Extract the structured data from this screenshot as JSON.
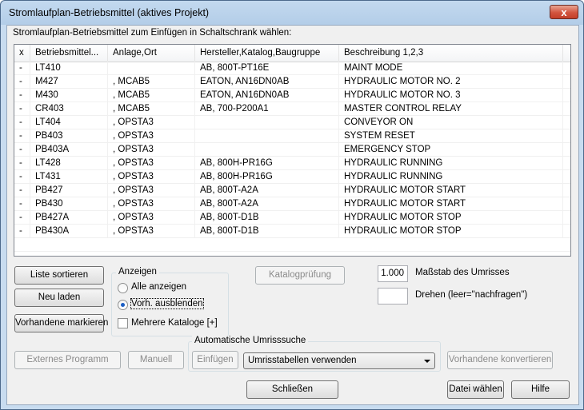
{
  "window": {
    "title": "Stromlaufplan-Betriebsmittel (aktives Projekt)",
    "close_glyph": "x"
  },
  "caption": "Stromlaufplan-Betriebsmittel zum Einfügen in Schaltschrank wählen:",
  "table": {
    "columns": [
      "x",
      "Betriebsmittel...",
      "Anlage,Ort",
      "Hersteller,Katalog,Baugruppe",
      "Beschreibung 1,2,3"
    ],
    "rows": [
      [
        "-",
        "LT410",
        "",
        "AB, 800T-PT16E",
        "MAINT MODE"
      ],
      [
        "-",
        "M427",
        ", MCAB5",
        "EATON, AN16DN0AB",
        "HYDRAULIC MOTOR NO. 2"
      ],
      [
        "-",
        "M430",
        ", MCAB5",
        "EATON, AN16DN0AB",
        "HYDRAULIC MOTOR NO. 3"
      ],
      [
        "-",
        "CR403",
        ", MCAB5",
        "AB, 700-P200A1",
        "MASTER CONTROL RELAY"
      ],
      [
        "-",
        "LT404",
        ", OPSTA3",
        "",
        "CONVEYOR ON"
      ],
      [
        "-",
        "PB403",
        ", OPSTA3",
        "",
        "SYSTEM RESET"
      ],
      [
        "-",
        "PB403A",
        ", OPSTA3",
        "",
        "EMERGENCY STOP"
      ],
      [
        "-",
        "LT428",
        ", OPSTA3",
        "AB, 800H-PR16G",
        "HYDRAULIC RUNNING"
      ],
      [
        "-",
        "LT431",
        ", OPSTA3",
        "AB, 800H-PR16G",
        "HYDRAULIC RUNNING"
      ],
      [
        "-",
        "PB427",
        ", OPSTA3",
        "AB, 800T-A2A",
        "HYDRAULIC MOTOR START"
      ],
      [
        "-",
        "PB430",
        ", OPSTA3",
        "AB, 800T-A2A",
        "HYDRAULIC MOTOR START"
      ],
      [
        "-",
        "PB427A",
        ", OPSTA3",
        "AB, 800T-D1B",
        "HYDRAULIC MOTOR STOP"
      ],
      [
        "-",
        "PB430A",
        ", OPSTA3",
        "AB, 800T-D1B",
        "HYDRAULIC MOTOR STOP"
      ]
    ]
  },
  "buttons": {
    "sort": "Liste sortieren",
    "reload": "Neu laden",
    "mark_existing": "Vorhandene markieren",
    "catalog_check": "Katalogprüfung",
    "external_program": "Externes Programm",
    "manual": "Manuell",
    "insert": "Einfügen",
    "convert_existing": "Vorhandene konvertieren",
    "close": "Schließen",
    "choose_file": "Datei wählen",
    "help": "Hilfe"
  },
  "display_group": {
    "label": "Anzeigen",
    "show_all": "Alle anzeigen",
    "hide_existing": "Vorh. ausblenden",
    "selected": "hide_existing",
    "multiple_catalogs": "Mehrere Kataloge [+]",
    "multiple_catalogs_checked": false
  },
  "scale": {
    "value": "1.000",
    "label": "Maßstab des Umrisses"
  },
  "rotate": {
    "value": "",
    "label": "Drehen (leer=\"nachfragen\")"
  },
  "auto_group": {
    "label": "Automatische Umrisssuche",
    "select_value": "Umrisstabellen verwenden"
  }
}
